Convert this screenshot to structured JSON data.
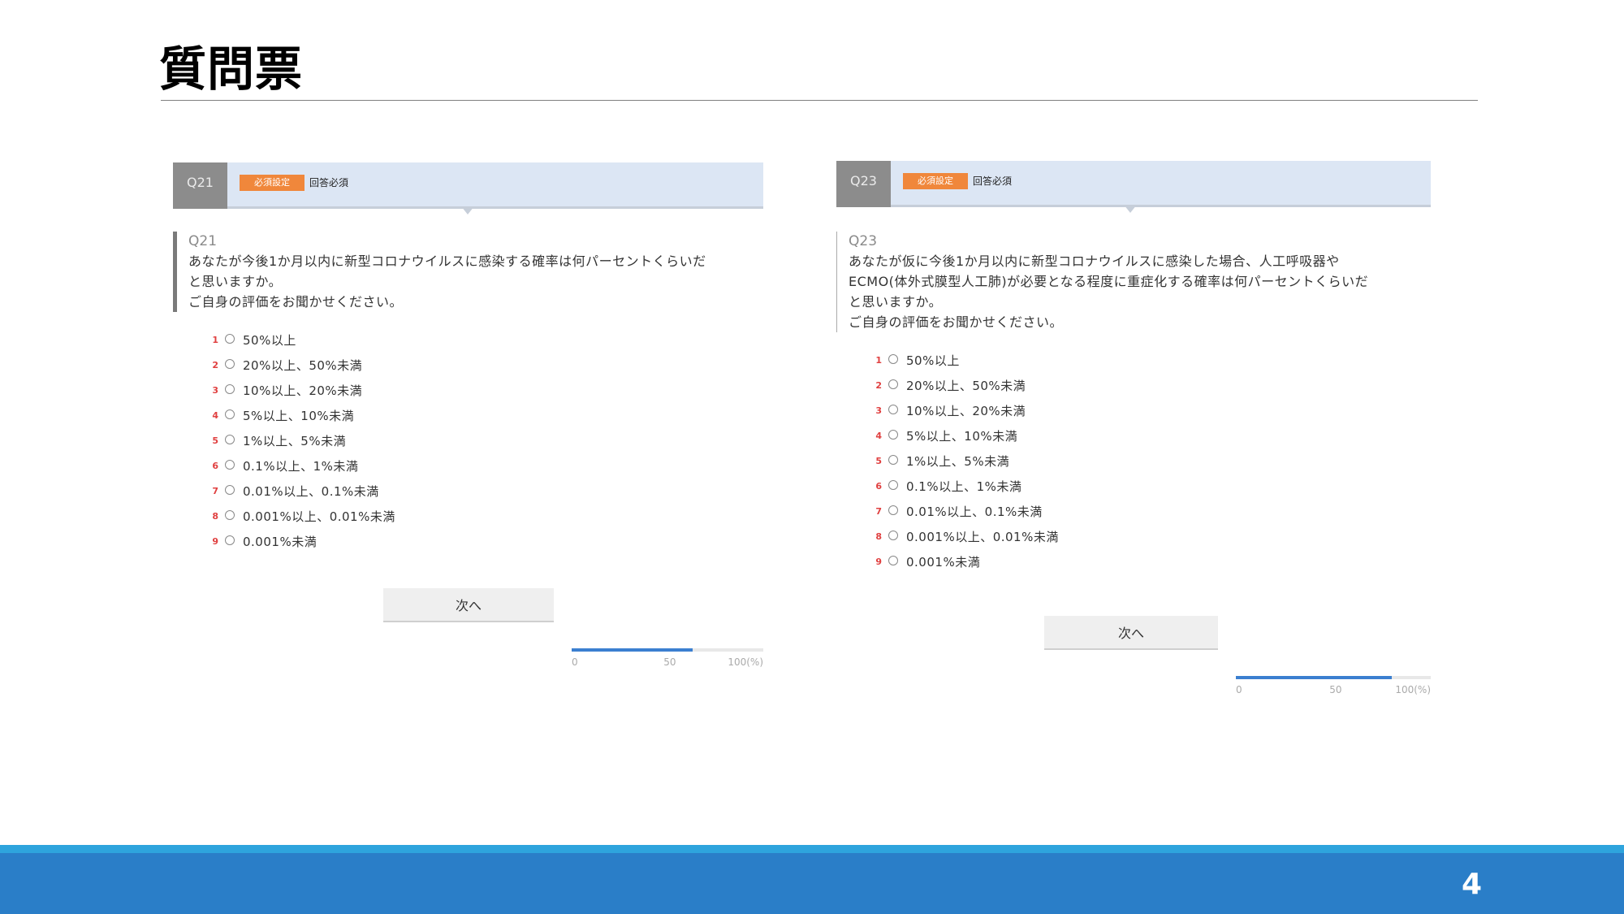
{
  "slide": {
    "title": "質問票",
    "page_number": "4"
  },
  "panels": [
    {
      "qid": "Q21",
      "required_tag": "必須設定",
      "required_text": "回答必須",
      "question_number": "Q21",
      "question_lines": [
        "あなたが今後1か月以内に新型コロナウイルスに感染する確率は何パーセントくらいだ",
        "と思いますか。",
        "ご自身の評価をお聞かせください。"
      ],
      "options": [
        {
          "num": "1",
          "label": "50%以上"
        },
        {
          "num": "2",
          "label": "20%以上、50%未満"
        },
        {
          "num": "3",
          "label": "10%以上、20%未満"
        },
        {
          "num": "4",
          "label": "5%以上、10%未満"
        },
        {
          "num": "5",
          "label": "1%以上、5%未満"
        },
        {
          "num": "6",
          "label": "0.1%以上、1%未満"
        },
        {
          "num": "7",
          "label": "0.01%以上、0.1%未満"
        },
        {
          "num": "8",
          "label": "0.001%以上、0.01%未満"
        },
        {
          "num": "9",
          "label": "0.001%未満"
        }
      ],
      "next_label": "次へ",
      "progress": {
        "value_percent": 63,
        "tick_labels": [
          "0",
          "50",
          "100(%)"
        ]
      }
    },
    {
      "qid": "Q23",
      "required_tag": "必須設定",
      "required_text": "回答必須",
      "question_number": "Q23",
      "question_lines": [
        "あなたが仮に今後1か月以内に新型コロナウイルスに感染した場合、人工呼吸器や",
        "ECMO(体外式膜型人工肺)が必要となる程度に重症化する確率は何パーセントくらいだ",
        "と思いますか。",
        "ご自身の評価をお聞かせください。"
      ],
      "options": [
        {
          "num": "1",
          "label": "50%以上"
        },
        {
          "num": "2",
          "label": "20%以上、50%未満"
        },
        {
          "num": "3",
          "label": "10%以上、20%未満"
        },
        {
          "num": "4",
          "label": "5%以上、10%未満"
        },
        {
          "num": "5",
          "label": "1%以上、5%未満"
        },
        {
          "num": "6",
          "label": "0.1%以上、1%未満"
        },
        {
          "num": "7",
          "label": "0.01%以上、0.1%未満"
        },
        {
          "num": "8",
          "label": "0.001%以上、0.01%未満"
        },
        {
          "num": "9",
          "label": "0.001%未満"
        }
      ],
      "next_label": "次へ",
      "progress": {
        "value_percent": 80,
        "tick_labels": [
          "0",
          "50",
          "100(%)"
        ]
      }
    }
  ]
}
